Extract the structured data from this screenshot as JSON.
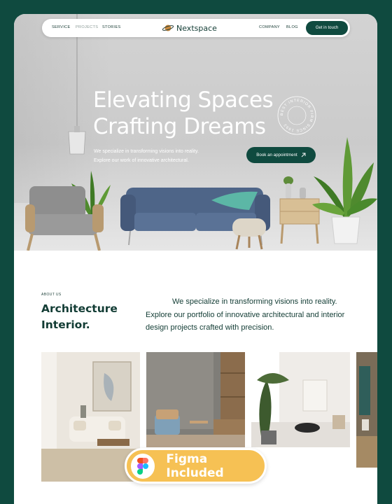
{
  "nav": {
    "links": [
      "SERVICE",
      "PROJECTS",
      "STORIES"
    ],
    "right_links": [
      "COMPANY",
      "BLOG"
    ],
    "brand": "Nextspace",
    "brand_icon": "planet-icon",
    "cta": "Get in touch"
  },
  "hero": {
    "title_line1": "Elevating Spaces",
    "title_line2": "Crafting Dreams",
    "desc_line1": "We specialize in transforming visions into reality.",
    "desc_line2": "Explore our work of innovative architectural.",
    "badge_text": "BEST INTERIOR FIRM SINCE 1992",
    "appointment": "Book an appointment",
    "appointment_icon": "arrow-up-right-icon"
  },
  "about": {
    "kicker": "ABOUT US",
    "heading_line1": "Architecture",
    "heading_line2": "Interior.",
    "text": "We specialize in transforming visions into reality. Explore our portfolio of innovative architectural and interior design projects crafted with precision."
  },
  "badge_overlay": {
    "label": "Figma Included",
    "icon": "figma-icon"
  },
  "colors": {
    "brand_green": "#0f4a3f",
    "text_dark": "#123c34",
    "pill_yellow": "#f6c154"
  }
}
